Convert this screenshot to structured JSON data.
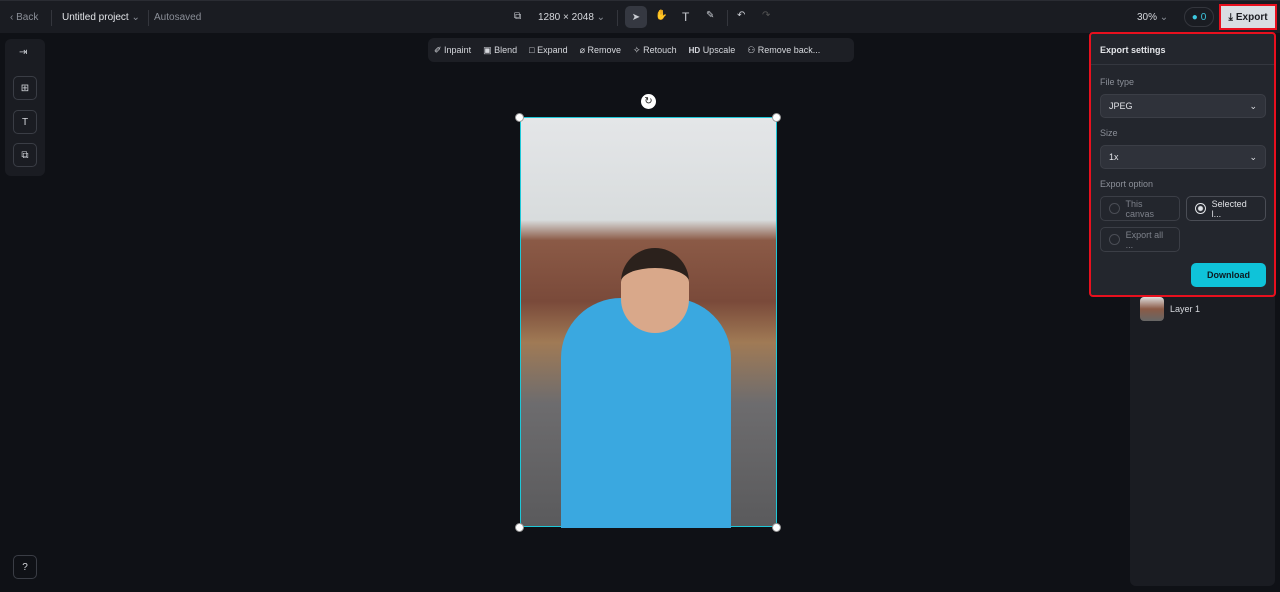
{
  "header": {
    "back": "Back",
    "project": "Untitled project",
    "autosaved": "Autosaved",
    "dimensions": "1280 × 2048",
    "zoom": "30%",
    "credits": "0",
    "export": "Export"
  },
  "toolbar": [
    "Inpaint",
    "Blend",
    "Expand",
    "Remove",
    "Retouch",
    "Upscale",
    "Remove back..."
  ],
  "upscale_badge": "HD",
  "export_panel": {
    "title": "Export settings",
    "file_type_label": "File type",
    "file_type": "JPEG",
    "size_label": "Size",
    "size": "1x",
    "option_label": "Export option",
    "options": [
      "This canvas",
      "Selected l...",
      "Export all ..."
    ],
    "selected_option": "Selected l...",
    "download": "Download",
    "accent": "#0fc3d9"
  },
  "layers": [
    {
      "name": "Layer 1"
    }
  ]
}
